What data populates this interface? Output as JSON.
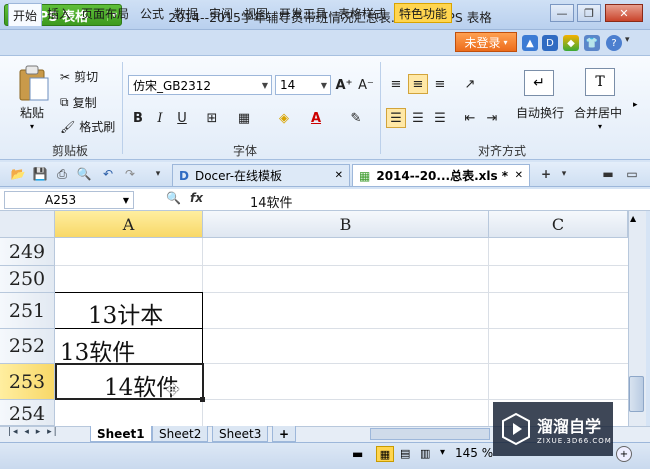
{
  "app": {
    "button_label": "WPS 表格",
    "logo_glyph": "S",
    "window_title": "2014--2015学年辅导员带班情况汇总表.xls * - WPS 表格"
  },
  "window_controls": {
    "minimize": "—",
    "restore": "❐",
    "close": "✕"
  },
  "menu": {
    "tabs": [
      "开始",
      "插入",
      "页面布局",
      "公式",
      "数据",
      "审阅",
      "视图",
      "开发工具",
      "表格样式",
      "特色功能"
    ],
    "active_tab": "开始",
    "special_tab": "特色功能",
    "login_label": "未登录"
  },
  "ribbon": {
    "clipboard": {
      "paste": "粘贴",
      "cut": "剪切",
      "copy": "复制",
      "format_painter": "格式刷",
      "group_label": "剪贴板"
    },
    "font": {
      "font_name": "仿宋_GB2312",
      "font_size": "14",
      "group_label": "字体",
      "bold": "B",
      "italic": "I",
      "underline": "U",
      "font_color_letter": "A"
    },
    "alignment": {
      "wrap_text": "自动换行",
      "merge_center": "合并居中",
      "group_label": "对齐方式"
    }
  },
  "doc_tabs": [
    {
      "label": "Docer-在线模板",
      "active": false
    },
    {
      "label": "2014--20...总表.xls *",
      "active": true
    }
  ],
  "formula_bar": {
    "cell_ref": "A253",
    "fx": "fx",
    "content": "14软件"
  },
  "grid": {
    "columns": [
      "A",
      "B",
      "C"
    ],
    "selected_column": "A",
    "rows": [
      "249",
      "250",
      "251",
      "252",
      "253",
      "254"
    ],
    "selected_row": "253",
    "cells": {
      "A251": "13计本",
      "A252": "13软件",
      "A253": "14软件"
    }
  },
  "sheets": {
    "tabs": [
      "Sheet1",
      "Sheet2",
      "Sheet3"
    ],
    "active": "Sheet1",
    "add": "+"
  },
  "status": {
    "zoom": "145 %"
  },
  "watermark": {
    "title": "溜溜自学",
    "subtitle": "ZIXUE.3D66.COM"
  },
  "colors": {
    "accent_green": "#3d9a1f",
    "login_orange": "#ec6c1c",
    "selection_yellow": "#f8d868",
    "special_tab": "#ffd54f"
  }
}
